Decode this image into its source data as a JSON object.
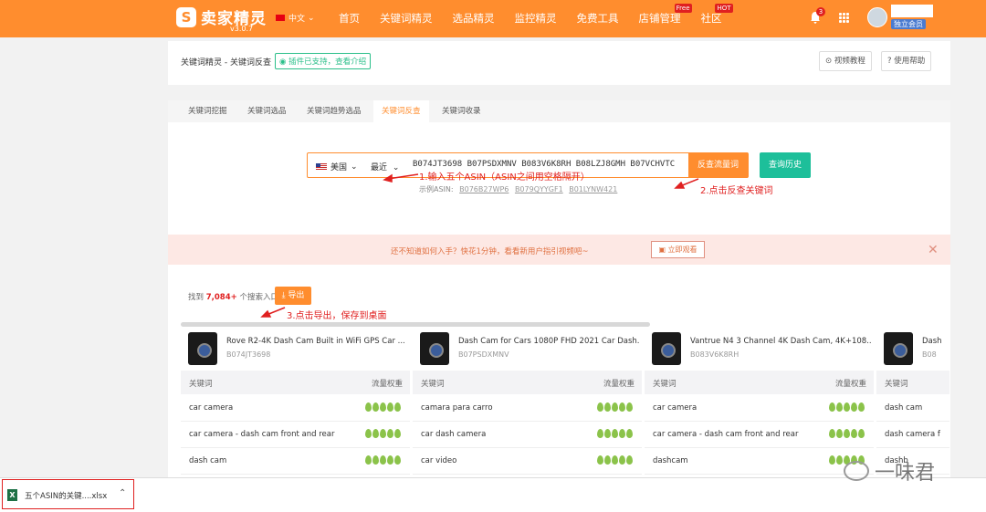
{
  "header": {
    "logo_mark": "S",
    "logo_text": "卖家精灵",
    "version": "v3.0.7",
    "language": "中文",
    "nav": [
      {
        "label": "首页"
      },
      {
        "label": "关键词精灵"
      },
      {
        "label": "选品精灵"
      },
      {
        "label": "监控精灵"
      },
      {
        "label": "免费工具"
      },
      {
        "label": "店铺管理",
        "badge": "Free"
      },
      {
        "label": "社区",
        "badge": "HOT"
      }
    ],
    "notification_count": "3",
    "member_badge": "独立会员"
  },
  "page": {
    "breadcrumb": "关键词精灵 - 关键词反查",
    "plugin_tag": "插件已支持，查看介绍",
    "video_tutorial": "视频教程",
    "help": "使用帮助",
    "tabs": [
      "关键词挖掘",
      "关键词选品",
      "关键词趋势选品",
      "关键词反查",
      "关键词收录"
    ],
    "active_tab": "关键词反查"
  },
  "search": {
    "country": "美国",
    "period": "最近",
    "asin_value": "B074JT3698 B07PSDXMNV B083V6K8RH B08LZJ8GMH B07VCHVTC",
    "reverse_button": "反查流量词",
    "history_button": "查询历史",
    "example_label": "示例ASIN:",
    "examples": [
      "B076B27WP6",
      "B079QYYGF1",
      "B01LYNW421"
    ]
  },
  "annotations": {
    "step1": "1.输入五个ASIN（ASIN之间用空格隔开）",
    "step2": "2.点击反查关键词",
    "step3": "3.点击导出，保存到桌面"
  },
  "banner": {
    "text": "还不知道如何入手？快花1分钟，看看新用户指引视频吧~",
    "watch_button": "立即观看"
  },
  "results": {
    "found_prefix": "找到",
    "found_count": "7,084+",
    "found_suffix": "个搜索入口",
    "export_button": "导出",
    "column_keyword": "关键词",
    "column_weight": "流量权重",
    "products": [
      {
        "title": "Rove R2-4K Dash Cam Built in WiFi GPS Car ...",
        "asin": "B074JT3698",
        "keywords": [
          "car camera",
          "car camera - dash cam front and rear",
          "dash cam"
        ]
      },
      {
        "title": "Dash Cam for Cars 1080P FHD 2021 Car Dash...",
        "asin": "B07PSDXMNV",
        "keywords": [
          "camara para carro",
          "car dash camera",
          "car video"
        ]
      },
      {
        "title": "Vantrue N4 3 Channel 4K Dash Cam, 4K+108...",
        "asin": "B083V6K8RH",
        "keywords": [
          "car camera",
          "car camera - dash cam front and rear",
          "dashcam"
        ]
      },
      {
        "title": "Dash",
        "asin": "B08",
        "keywords": [
          "dash cam",
          "dash camera f",
          "dashb"
        ]
      }
    ]
  },
  "download": {
    "file_name": "五个ASIN的关键....xlsx",
    "icon": "excel-icon"
  },
  "watermark": "一味君",
  "colors": {
    "brand": "#ff8d2e",
    "teal": "#1dbf9a",
    "annotation": "#e02020"
  }
}
